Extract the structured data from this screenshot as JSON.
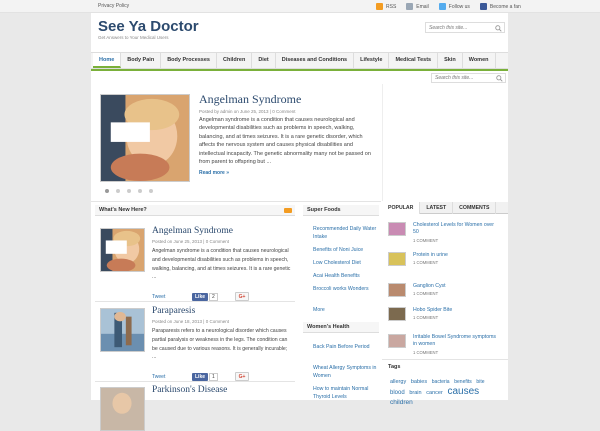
{
  "topbar": {
    "policy": "Privacy Policy",
    "rss": "RSS",
    "email": "Email",
    "follow": "Follow us",
    "fan": "Become a fan"
  },
  "header": {
    "title": "See Ya Doctor",
    "tagline": "Get Answers to Your Medical Users",
    "search_placeholder": "Search this site..."
  },
  "nav": [
    "Home",
    "Body Pain",
    "Body Processes",
    "Children",
    "Diet",
    "Diseases and Conditions",
    "Lifestyle",
    "Medical Tests",
    "Skin",
    "Women"
  ],
  "sidebar": {
    "search_placeholder": "Search this site..."
  },
  "featured": {
    "title": "Angelman Syndrome",
    "meta": "Posted by admin on June 25, 2013  |  0 Comment",
    "text": "Angelman syndrome is a condition that causes neurological and developmental disabilities such as problems in speech, walking, balancing, and at times seizures. It is a rare genetic disorder, which affects the nervous system and causes physical disabilities and intellectual incapacity. The genetic abnormality many not be passed on from parent to offspring but ...",
    "more": "Read more »",
    "active_slide": 1,
    "slide_count": 5
  },
  "whats_new": {
    "heading": "What's New Here?",
    "posts": [
      {
        "title": "Angelman Syndrome",
        "meta": "Posted on June 25, 2013  |  0 Comment",
        "text": "Angelman syndrome is a condition that causes neurological and developmental disabilities such as problems in speech, walking, balancing, and at times seizures. It is a rare genetic ...",
        "tweet": "Tweet",
        "like": "Like",
        "like_count": "2",
        "gplus": "G+"
      },
      {
        "title": "Paraparesis",
        "meta": "Posted on June 18, 2013  |  0 Comment",
        "text": "Paraparesis refers to a neurological disorder which causes partial paralysis or weakness in the legs. The condition can be caused due to various reasons. It is generally incurable; ...",
        "tweet": "Tweet",
        "like": "Like",
        "like_count": "1",
        "gplus": "G+"
      },
      {
        "title": "Parkinson's Disease",
        "meta": "",
        "text": "",
        "tweet": "",
        "like": "",
        "like_count": "",
        "gplus": ""
      }
    ]
  },
  "super_foods": {
    "heading": "Super Foods",
    "items": [
      "Recommended Daily Water Intake",
      "Benefits of Noni Juice",
      "Low Cholesterol Diet",
      "Acai Health Benefits",
      "Broccoli works Wonders",
      "More"
    ]
  },
  "womens_health": {
    "heading": "Women's Health",
    "items": [
      "Back Pain Before Period",
      "Wheat Allergy Symptoms in Women",
      "How to maintain Normal Thyroid Levels"
    ]
  },
  "tabs": [
    "POPULAR",
    "LATEST",
    "COMMENTS"
  ],
  "popular": [
    {
      "title": "Cholesterol Levels for Women over 50",
      "count": "1 COMMENT"
    },
    {
      "title": "Protein in urine",
      "count": "1 COMMENT"
    },
    {
      "title": "Ganglion Cyst",
      "count": "1 COMMENT"
    },
    {
      "title": "Hobo Spider Bite",
      "count": "1 COMMENT"
    },
    {
      "title": "Irritable Bowel Syndrome symptoms in women",
      "count": "1 COMMENT"
    }
  ],
  "tags_heading": "Tags",
  "tags": [
    "allergy",
    "babies",
    "bacteria",
    "benefits",
    "bite",
    "blood",
    "brain",
    "cancer",
    "causes",
    "children"
  ],
  "colors": {
    "brand": "#2c4a6e",
    "link": "#2a6fa8",
    "accent_green": "#7ab03a",
    "rss_orange": "#f39c22"
  }
}
